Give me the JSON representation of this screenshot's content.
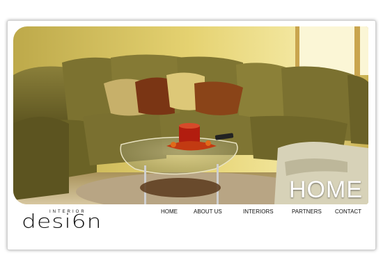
{
  "hero": {
    "title": "HOME"
  },
  "logo": {
    "small_text": "INTERIOR",
    "big_text": "desi6n"
  },
  "nav": {
    "items": [
      {
        "label": "HOME"
      },
      {
        "label": "ABOUT US"
      },
      {
        "label": "INTERIORS"
      },
      {
        "label": "PARTNERS"
      },
      {
        "label": "CONTACT"
      }
    ]
  },
  "colors": {
    "sofa": "#6b6326",
    "wall": "#e8d675",
    "pillow_orange": "#7a3514",
    "pillow_cream": "#d9c46d",
    "nav_text": "#111111"
  }
}
